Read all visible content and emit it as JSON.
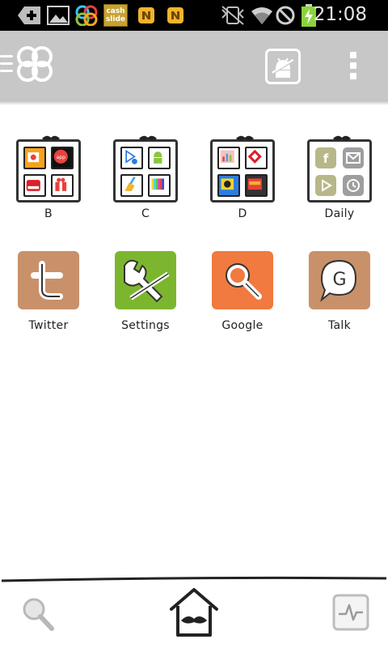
{
  "status_bar": {
    "time": "21:08",
    "notification_icons": [
      "add-icon",
      "image-icon",
      "go-launcher-icon",
      "cashslide-icon",
      "notification-n-icon",
      "notification-n-icon"
    ],
    "cashslide_text": "cash slide",
    "system_icons": [
      "vibrate-icon",
      "wifi-icon",
      "blocked-icon",
      "battery-charging-icon"
    ]
  },
  "action_bar": {
    "icons": [
      "menu-lines-icon",
      "go-launcher-logo-icon",
      "android-debug-icon",
      "overflow-menu-icon"
    ]
  },
  "grid": {
    "folders": [
      {
        "label": "B",
        "minis": [
          "contacts",
          "app",
          "market",
          "gift"
        ]
      },
      {
        "label": "C",
        "minis": [
          "play-store",
          "android",
          "brush",
          "tv-bars"
        ]
      },
      {
        "label": "D",
        "minis": [
          "chart",
          "diamond",
          "photo",
          "games"
        ]
      },
      {
        "label": "Daily",
        "minis": [
          "facebook",
          "mail",
          "play",
          "clock"
        ]
      }
    ],
    "apps": [
      {
        "label": "Twitter",
        "icon": "twitter-icon",
        "color": "#c9916a"
      },
      {
        "label": "Settings",
        "icon": "settings-tools-icon",
        "color": "#7cb62e"
      },
      {
        "label": "Google",
        "icon": "magnifier-icon",
        "color": "#f07a3f"
      },
      {
        "label": "Talk",
        "icon": "talk-bubble-icon",
        "color": "#c9916a"
      }
    ]
  },
  "dock": {
    "icons": [
      "search-icon",
      "home-mustache-icon",
      "pulse-icon"
    ]
  },
  "colors": {
    "status_bar": "#000000",
    "action_bar": "#c7c7c7",
    "tan_tile": "#c9916a",
    "green_tile": "#7cb62e",
    "orange_tile": "#f07a3f"
  }
}
